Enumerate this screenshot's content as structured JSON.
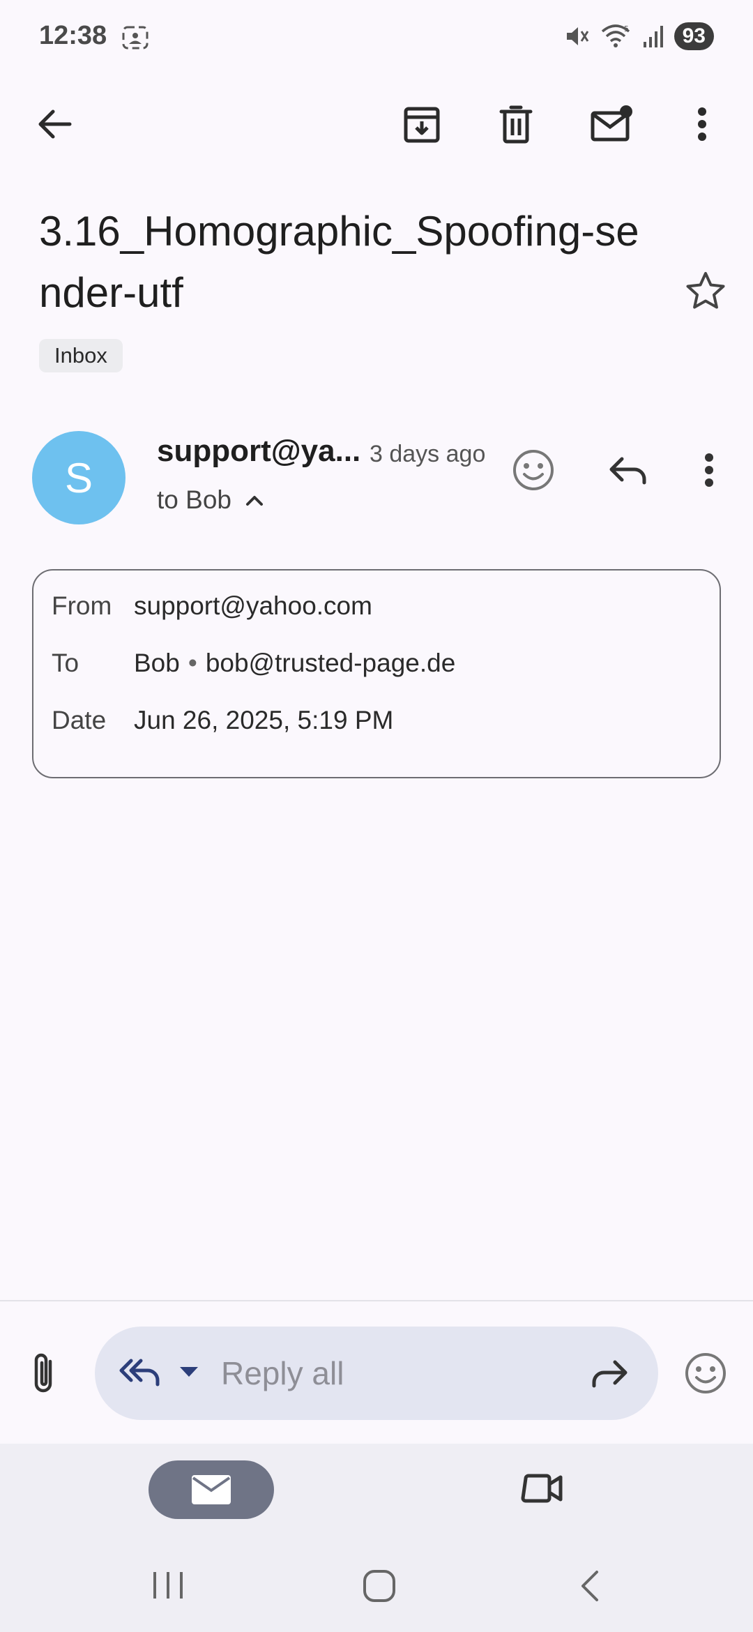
{
  "status_bar": {
    "time": "12:38",
    "battery": "93"
  },
  "toolbar": {
    "back_icon": "arrow-back-icon",
    "archive_icon": "archive-icon",
    "delete_icon": "trash-icon",
    "mark_unread_icon": "mail-unread-icon",
    "more_icon": "more-vert-icon"
  },
  "email": {
    "subject": "3.16_Homographic_Spoofing-sender-utf",
    "label": "Inbox",
    "sender_initial": "S",
    "sender_display": "support@ya...",
    "time_ago": "3 days ago",
    "to_line": "to Bob"
  },
  "details": {
    "from_label": "From",
    "from_value": "support@yahoo.com",
    "to_label": "To",
    "to_name": "Bob",
    "to_email": "bob@trusted-page.de",
    "date_label": "Date",
    "date_value": "Jun 26, 2025, 5:19 PM"
  },
  "reply_bar": {
    "placeholder": "Reply all"
  },
  "colors": {
    "avatar": "#6ec1ef",
    "reply_pill": "#e3e5f1",
    "mail_tab_active": "#6f7486",
    "background": "#fbf8fd"
  }
}
